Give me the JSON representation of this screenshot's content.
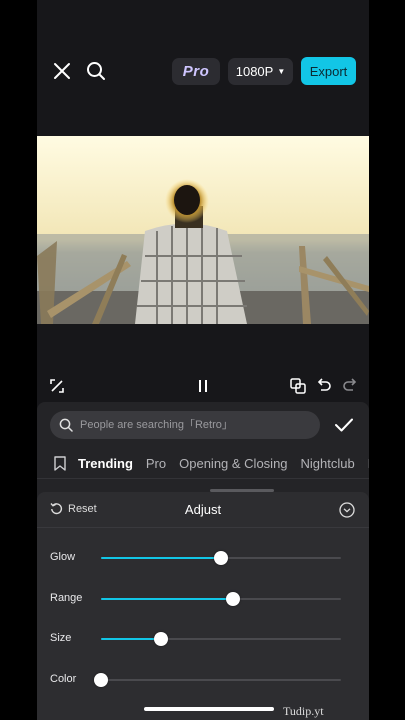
{
  "topbar": {
    "close_icon": "close-icon",
    "search_icon": "search-icon",
    "pro_label": "Pro",
    "resolution_label": "1080P",
    "export_label": "Export",
    "accent_color": "#12c6e6"
  },
  "controls": {
    "fullscreen_icon": "fullscreen-icon",
    "pause_icon": "pause-icon",
    "compare_icon": "compare-icon",
    "undo_icon": "undo-icon",
    "redo_icon": "redo-icon"
  },
  "effects": {
    "search_placeholder": "People are searching「Retro」",
    "confirm_icon": "check-icon",
    "tabs": [
      "Trending",
      "Pro",
      "Opening & Closing",
      "Nightclub",
      "L"
    ],
    "active_tab": "Trending"
  },
  "adjust": {
    "reset_label": "Reset",
    "title": "Adjust",
    "sliders": [
      {
        "label": "Glow",
        "value": 0.5
      },
      {
        "label": "Range",
        "value": 0.55
      },
      {
        "label": "Size",
        "value": 0.25
      },
      {
        "label": "Color",
        "value": 0.0
      }
    ]
  },
  "watermark": "Tudip.yt"
}
